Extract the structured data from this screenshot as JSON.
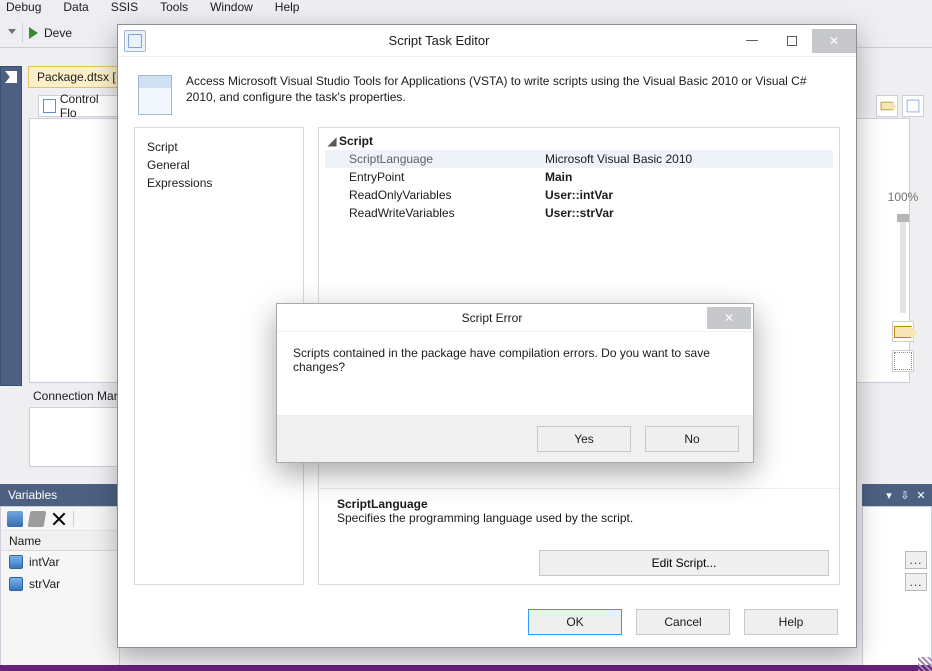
{
  "menu": {
    "items": [
      "Debug",
      "Data",
      "SSIS",
      "Tools",
      "Window",
      "Help"
    ]
  },
  "toolbar": {
    "run_config": "Deve"
  },
  "document": {
    "tab": "Package.dtsx [",
    "subtab": "Control Flo"
  },
  "right_gutter": {
    "zoom": "100%"
  },
  "connection_managers": {
    "title": "Connection Man"
  },
  "variables": {
    "title": "Variables",
    "column": "Name",
    "rows": [
      "intVar",
      "strVar"
    ]
  },
  "pinbar": {
    "tri": "▾",
    "pin": "⇩",
    "x": "✕"
  },
  "mini_ellipsis": [
    "...",
    "..."
  ],
  "dialog": {
    "title": "Script Task Editor",
    "sys_close": "✕",
    "description": "Access Microsoft Visual Studio Tools for Applications (VSTA) to write scripts using the Visual Basic 2010 or Visual C# 2010, and configure the task's properties.",
    "side": [
      "Script",
      "General",
      "Expressions"
    ],
    "grid": {
      "twist": "◢",
      "category": "Script",
      "rows": [
        {
          "name": "ScriptLanguage",
          "value": "Microsoft Visual Basic 2010",
          "selected": true
        },
        {
          "name": "EntryPoint",
          "value": "Main",
          "bold": true
        },
        {
          "name": "ReadOnlyVariables",
          "value": "User::intVar",
          "bold": true
        },
        {
          "name": "ReadWriteVariables",
          "value": "User::strVar",
          "bold": true
        }
      ],
      "help_title": "ScriptLanguage",
      "help_text": "Specifies the programming language used by the script.",
      "edit_button": "Edit Script..."
    },
    "buttons": {
      "ok": "OK",
      "cancel": "Cancel",
      "help": "Help"
    }
  },
  "error_dialog": {
    "title": "Script Error",
    "close": "✕",
    "message": "Scripts contained in the package have compilation errors. Do you want to save changes?",
    "yes": "Yes",
    "no": "No"
  }
}
